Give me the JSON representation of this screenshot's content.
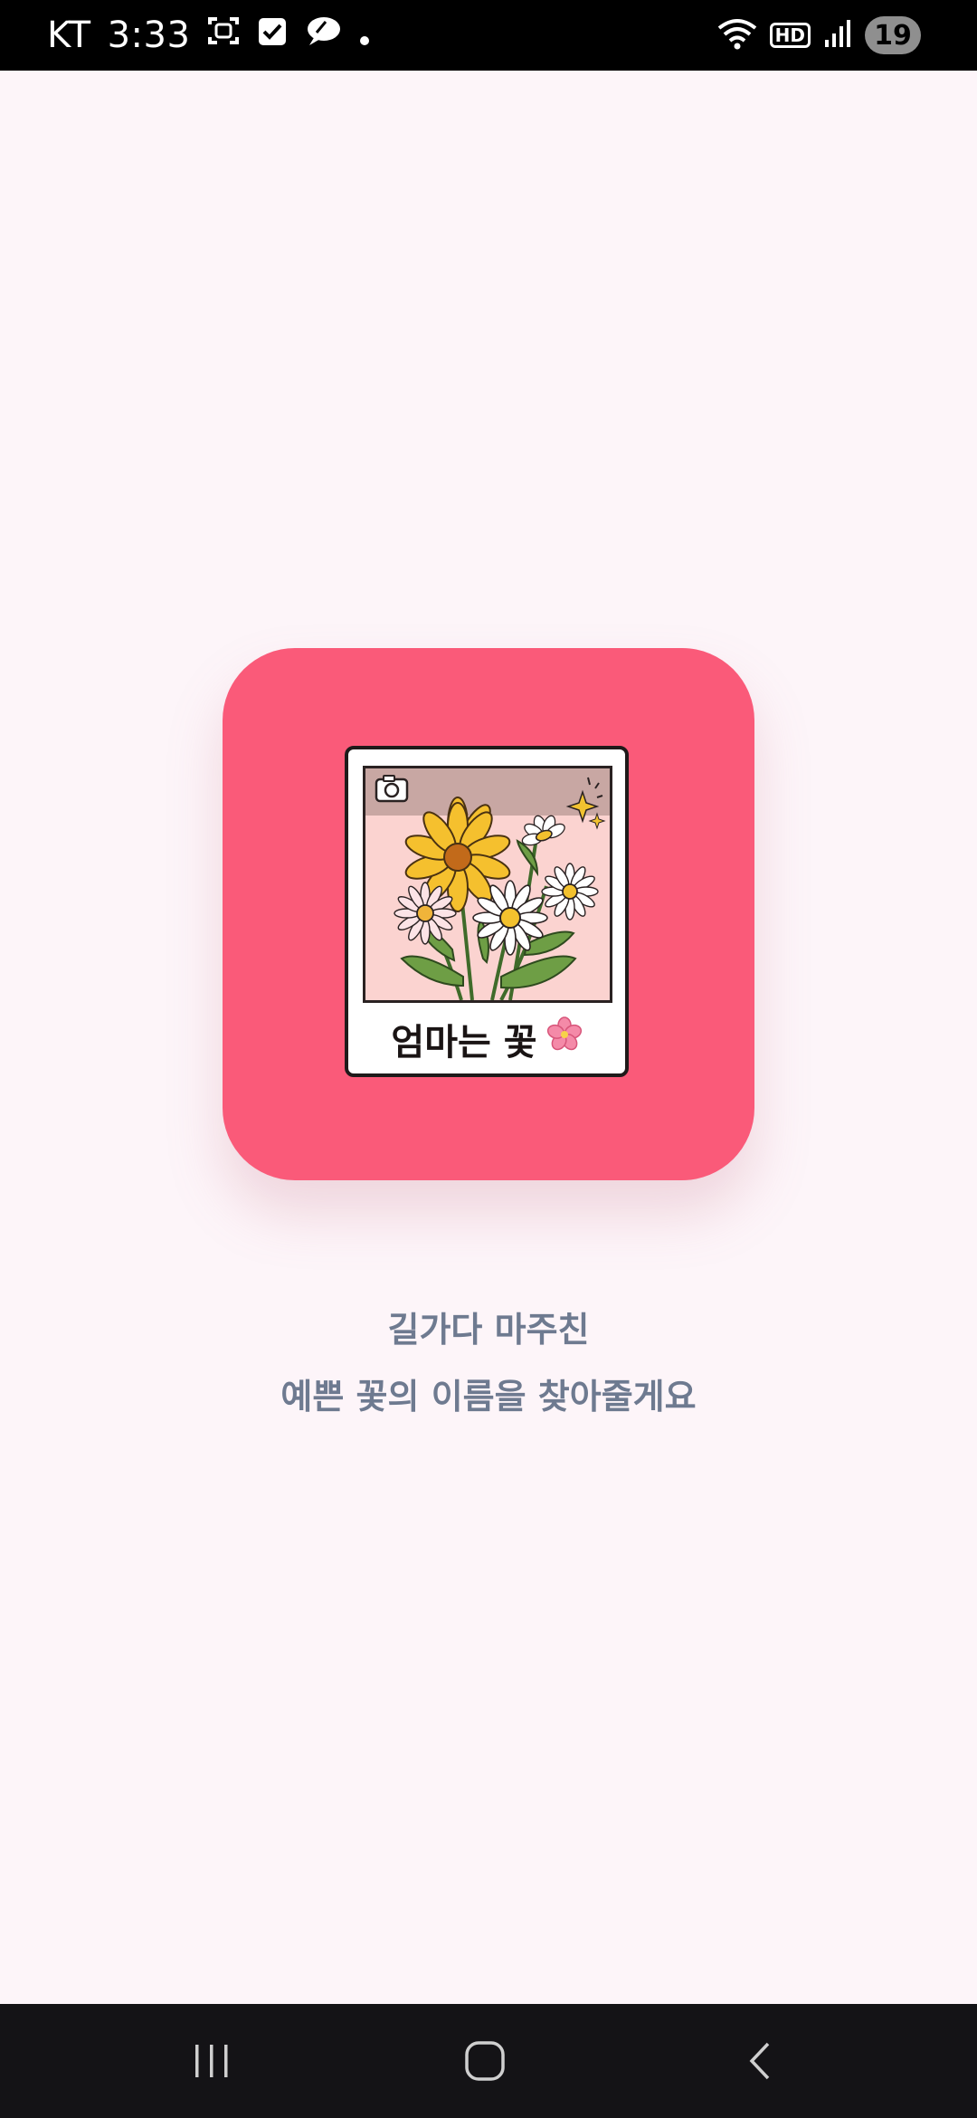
{
  "status_bar": {
    "carrier": "KT",
    "time": "3:33",
    "hd": "HD",
    "battery": "19",
    "icons": [
      "screenshot-icon",
      "checkbox-icon",
      "talk-bubble-icon",
      "dot-icon",
      "wifi-icon",
      "hd-icon",
      "signal-icon",
      "battery-icon"
    ]
  },
  "app_icon": {
    "caption": "엄마는 꽃",
    "emoji": "🌸",
    "background": "#FA5A79"
  },
  "tagline": {
    "line1": "길가다 마주친",
    "line2": "예쁜 꽃의 이름을 찾아줄게요"
  },
  "colors": {
    "background": "#FDF5F9",
    "text": "#6E7A90",
    "accent": "#FA5A79"
  }
}
